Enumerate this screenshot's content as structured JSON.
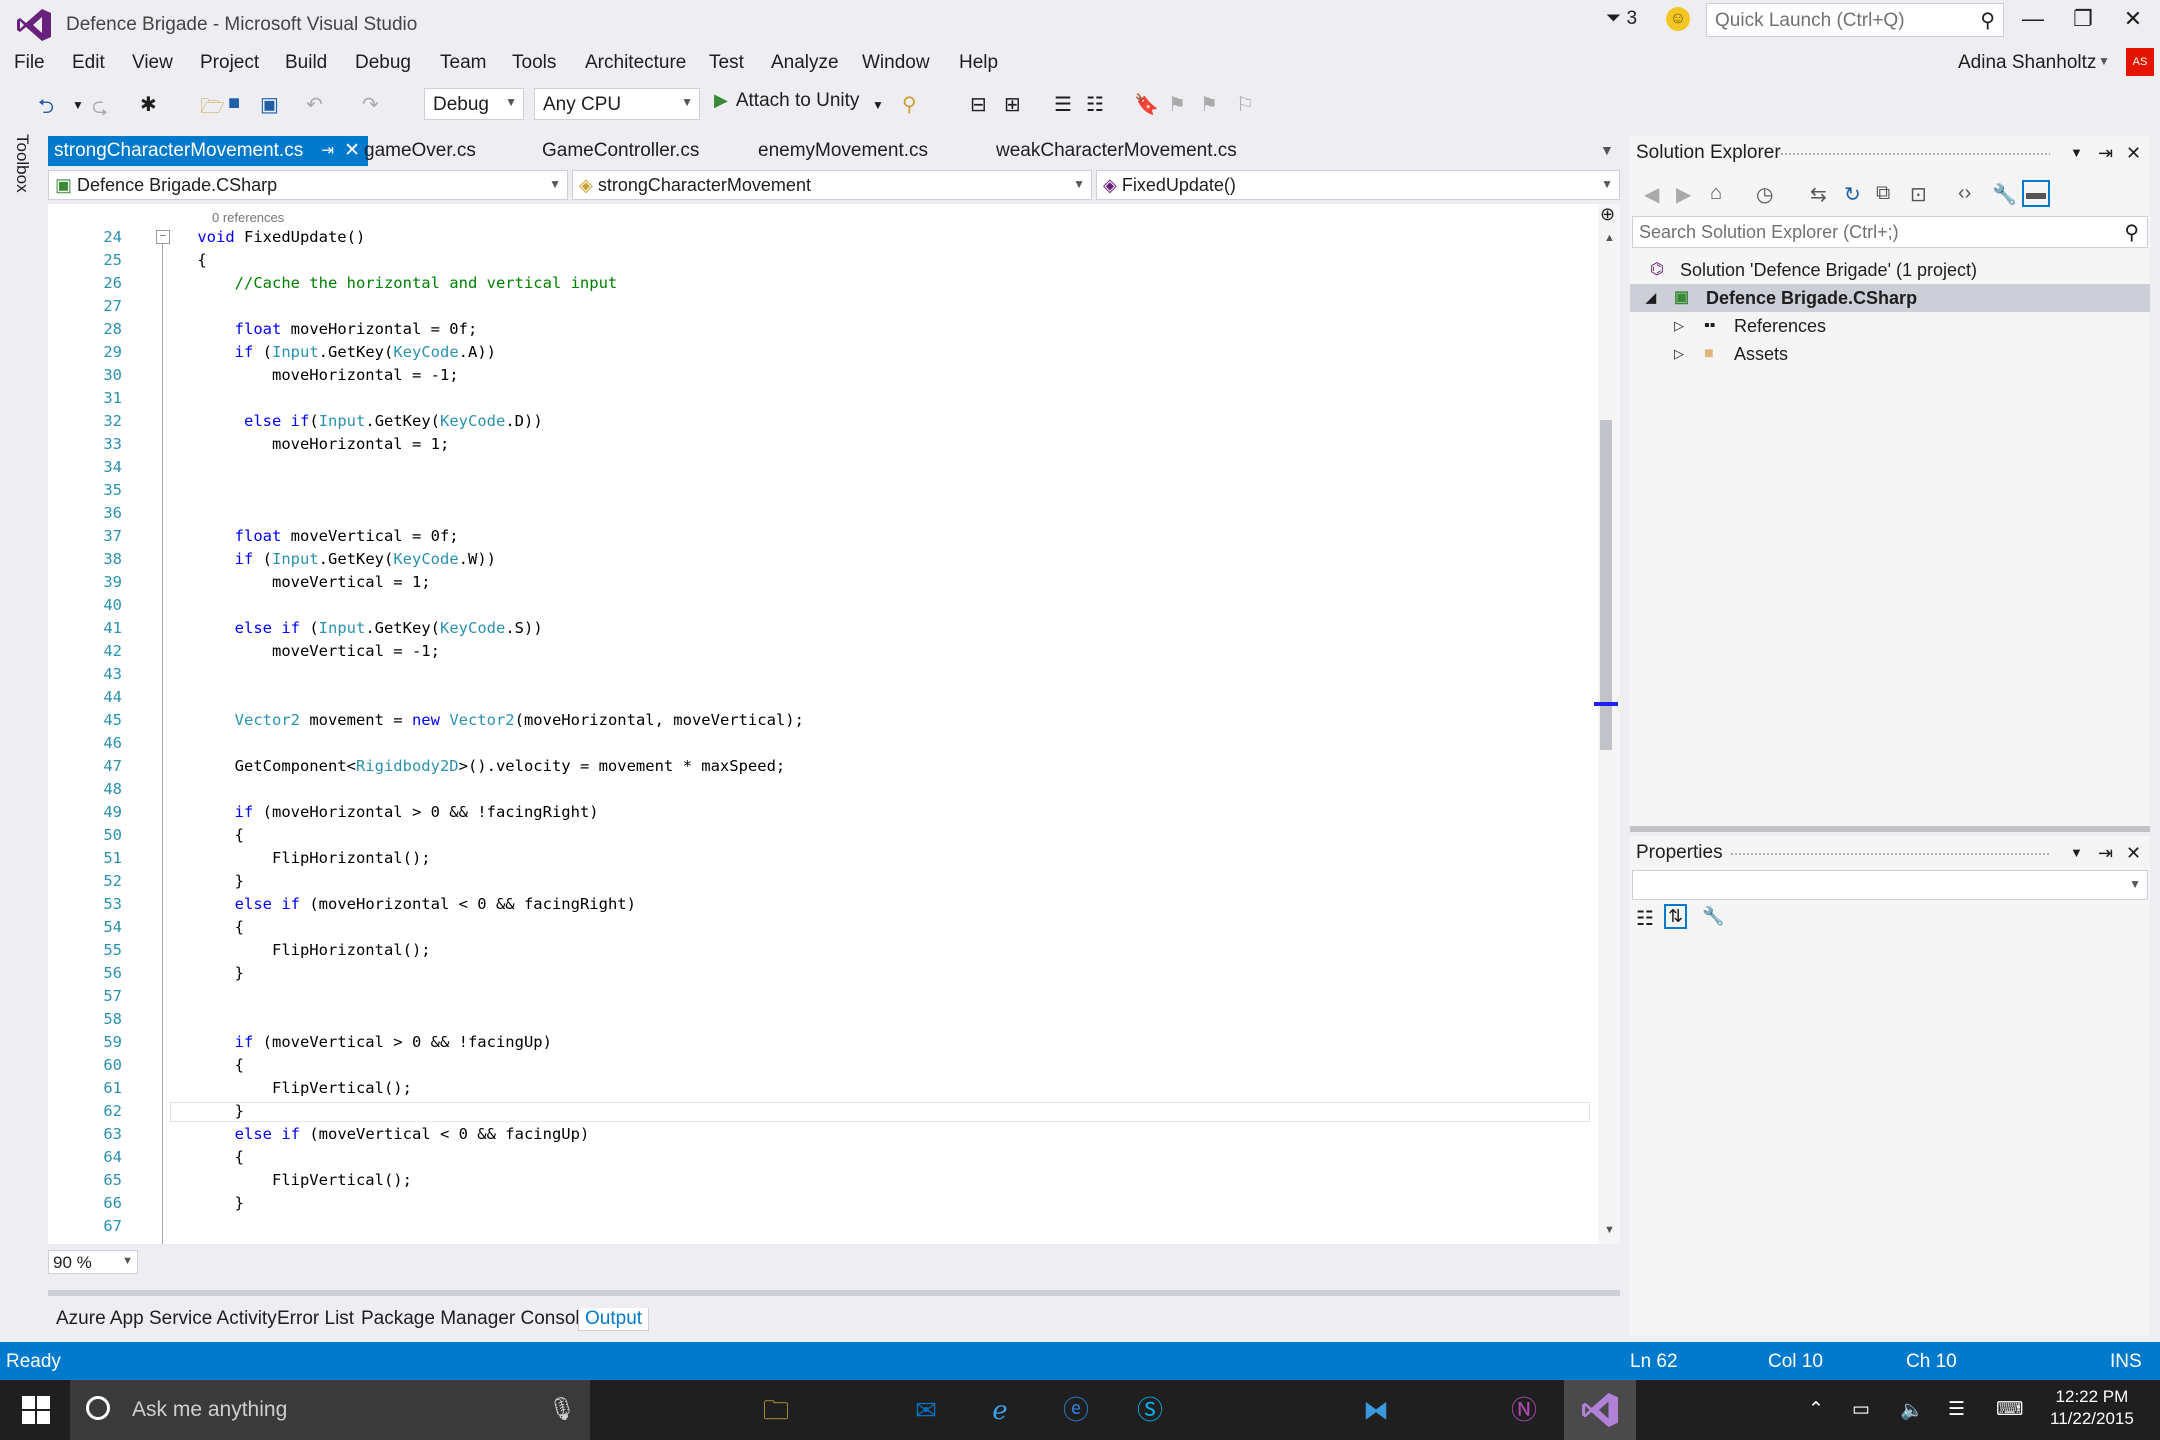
{
  "window": {
    "title": "Defence Brigade - Microsoft Visual Studio",
    "notification_count": "3",
    "quick_launch_placeholder": "Quick Launch (Ctrl+Q)",
    "user": "Adina Shanholtz",
    "avatar_initials": "AS"
  },
  "menu": [
    "File",
    "Edit",
    "View",
    "Project",
    "Build",
    "Debug",
    "Team",
    "Tools",
    "Architecture",
    "Test",
    "Analyze",
    "Window",
    "Help"
  ],
  "toolbar": {
    "config": "Debug",
    "platform": "Any CPU",
    "attach_label": "Attach to Unity"
  },
  "toolbox_label": "Toolbox",
  "tabs": [
    {
      "label": "strongCharacterMovement.cs",
      "active": true
    },
    {
      "label": "gameOver.cs"
    },
    {
      "label": "GameController.cs"
    },
    {
      "label": "enemyMovement.cs"
    },
    {
      "label": "weakCharacterMovement.cs"
    }
  ],
  "navbar": {
    "project": "Defence Brigade.CSharp",
    "class": "strongCharacterMovement",
    "member": "FixedUpdate()"
  },
  "editor": {
    "codelens": "0 references",
    "zoom": "90 %",
    "lines": [
      {
        "n": "24",
        "t": "    <k>void</k> FixedUpdate()"
      },
      {
        "n": "25",
        "t": "    {"
      },
      {
        "n": "26",
        "t": "        <c>//Cache the horizontal and vertical input</c>"
      },
      {
        "n": "27",
        "t": ""
      },
      {
        "n": "28",
        "t": "        <k>float</k> moveHorizontal = 0f;"
      },
      {
        "n": "29",
        "t": "        <k>if</k> (<y>Input</y>.GetKey(<y>KeyCode</y>.A))"
      },
      {
        "n": "30",
        "t": "            moveHorizontal = -1;"
      },
      {
        "n": "31",
        "t": ""
      },
      {
        "n": "32",
        "t": "         <k>else</k> <k>if</k>(<y>Input</y>.GetKey(<y>KeyCode</y>.D))"
      },
      {
        "n": "33",
        "t": "            moveHorizontal = 1;"
      },
      {
        "n": "34",
        "t": ""
      },
      {
        "n": "35",
        "t": ""
      },
      {
        "n": "36",
        "t": ""
      },
      {
        "n": "37",
        "t": "        <k>float</k> moveVertical = 0f;"
      },
      {
        "n": "38",
        "t": "        <k>if</k> (<y>Input</y>.GetKey(<y>KeyCode</y>.W))"
      },
      {
        "n": "39",
        "t": "            moveVertical = 1;"
      },
      {
        "n": "40",
        "t": ""
      },
      {
        "n": "41",
        "t": "        <k>else</k> <k>if</k> (<y>Input</y>.GetKey(<y>KeyCode</y>.S))"
      },
      {
        "n": "42",
        "t": "            moveVertical = -1;"
      },
      {
        "n": "43",
        "t": ""
      },
      {
        "n": "44",
        "t": ""
      },
      {
        "n": "45",
        "t": "        <y>Vector2</y> movement = <k>new</k> <y>Vector2</y>(moveHorizontal, moveVertical);"
      },
      {
        "n": "46",
        "t": ""
      },
      {
        "n": "47",
        "t": "        GetComponent&lt;<y>Rigidbody2D</y>&gt;().velocity = movement * maxSpeed;"
      },
      {
        "n": "48",
        "t": ""
      },
      {
        "n": "49",
        "t": "        <k>if</k> (moveHorizontal &gt; 0 &amp;&amp; !facingRight)"
      },
      {
        "n": "50",
        "t": "        {"
      },
      {
        "n": "51",
        "t": "            FlipHorizontal();"
      },
      {
        "n": "52",
        "t": "        }"
      },
      {
        "n": "53",
        "t": "        <k>else</k> <k>if</k> (moveHorizontal &lt; 0 &amp;&amp; facingRight)"
      },
      {
        "n": "54",
        "t": "        {"
      },
      {
        "n": "55",
        "t": "            FlipHorizontal();"
      },
      {
        "n": "56",
        "t": "        }"
      },
      {
        "n": "57",
        "t": ""
      },
      {
        "n": "58",
        "t": ""
      },
      {
        "n": "59",
        "t": "        <k>if</k> (moveVertical &gt; 0 &amp;&amp; !facingUp)"
      },
      {
        "n": "60",
        "t": "        {"
      },
      {
        "n": "61",
        "t": "            FlipVertical();"
      },
      {
        "n": "62",
        "t": "        }"
      },
      {
        "n": "63",
        "t": "        <k>else</k> <k>if</k> (moveVertical &lt; 0 &amp;&amp; facingUp)"
      },
      {
        "n": "64",
        "t": "        {"
      },
      {
        "n": "65",
        "t": "            FlipVertical();"
      },
      {
        "n": "66",
        "t": "        }"
      },
      {
        "n": "67",
        "t": ""
      }
    ]
  },
  "bottom_tabs": [
    "Azure App Service Activity",
    "Error List",
    "Package Manager Console",
    "Output"
  ],
  "solution_explorer": {
    "title": "Solution Explorer",
    "search_placeholder": "Search Solution Explorer (Ctrl+;)",
    "nodes": [
      {
        "label": "Solution 'Defence Brigade' (1 project)",
        "level": 0
      },
      {
        "label": "Defence Brigade.CSharp",
        "level": 1,
        "selected": true
      },
      {
        "label": "References",
        "level": 2
      },
      {
        "label": "Assets",
        "level": 2
      }
    ]
  },
  "properties": {
    "title": "Properties"
  },
  "status": {
    "state": "Ready",
    "ln": "Ln 62",
    "col": "Col 10",
    "ch": "Ch 10",
    "mode": "INS"
  },
  "taskbar": {
    "search_placeholder": "Ask me anything",
    "time": "12:22 PM",
    "date": "11/22/2015"
  },
  "colors": {
    "accent": "#007acc",
    "keyword": "#0000ff",
    "type": "#2b91af",
    "comment": "#008000",
    "vs_purple": "#68217a"
  }
}
